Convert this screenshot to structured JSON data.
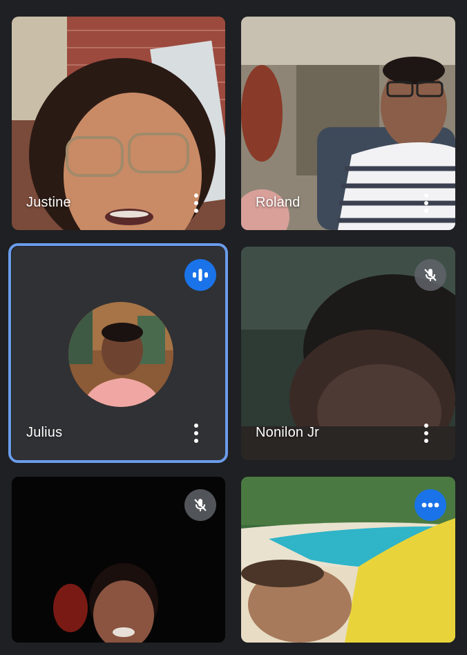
{
  "participants": [
    {
      "name": "Justine",
      "status": "none"
    },
    {
      "name": "Roland",
      "status": "none"
    },
    {
      "name": "Julius",
      "status": "speaking",
      "active": true
    },
    {
      "name": "Nonilon Jr",
      "status": "muted"
    },
    {
      "name": "",
      "status": "muted"
    },
    {
      "name": "",
      "status": "typing"
    }
  ],
  "icons": {
    "more": "more-vert-icon",
    "muted": "mic-off-icon",
    "speaking": "audio-level-icon",
    "typing": "more-horiz-icon"
  },
  "colors": {
    "background": "#1f2023",
    "tile": "#3c4043",
    "active_border": "#6a9ceb",
    "accent_blue": "#1a73e8"
  }
}
